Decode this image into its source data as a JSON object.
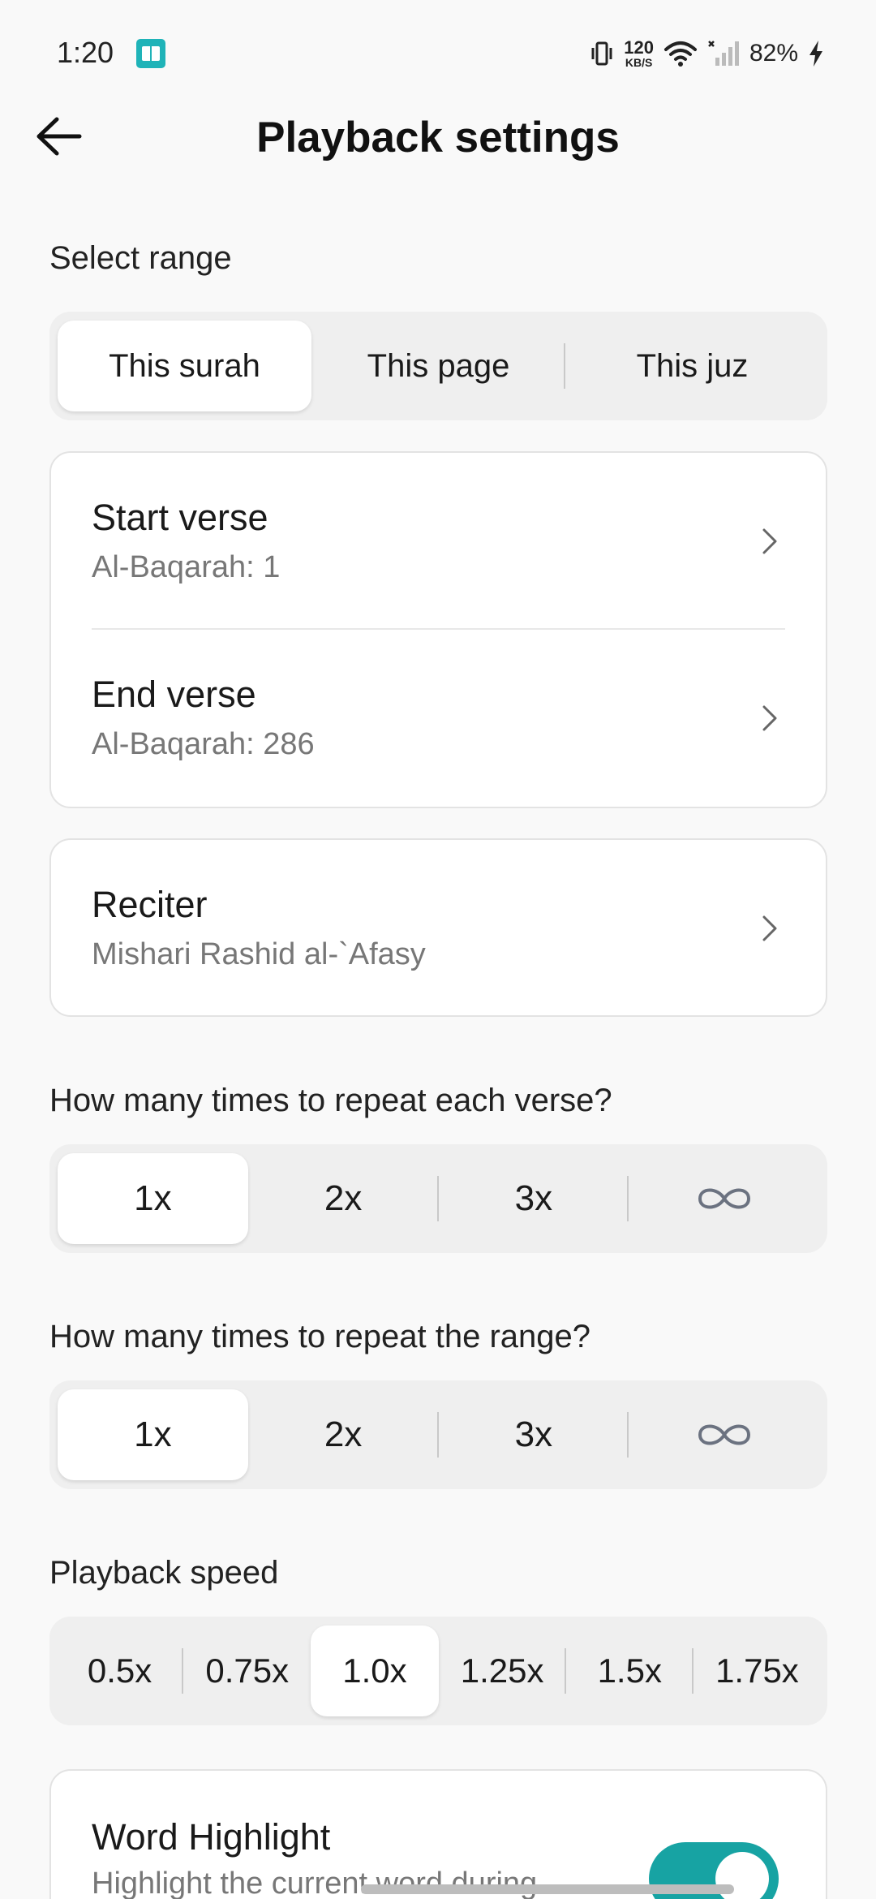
{
  "status_bar": {
    "time": "1:20",
    "net_speed_value": "120",
    "net_speed_unit": "KB/S",
    "battery": "82%"
  },
  "header": {
    "title": "Playback settings"
  },
  "range": {
    "label": "Select range",
    "options": [
      "This surah",
      "This page",
      "This juz"
    ],
    "selected": "This surah"
  },
  "verses": {
    "start_title": "Start verse",
    "start_value": "Al-Baqarah: 1",
    "end_title": "End verse",
    "end_value": "Al-Baqarah: 286"
  },
  "reciter": {
    "title": "Reciter",
    "value": "Mishari Rashid al-`Afasy"
  },
  "verse_repeat": {
    "label": "How many times to repeat each verse?",
    "options": [
      "1x",
      "2x",
      "3x"
    ],
    "selected": "1x"
  },
  "range_repeat": {
    "label": "How many times to repeat the range?",
    "options": [
      "1x",
      "2x",
      "3x"
    ],
    "selected": "1x"
  },
  "speed": {
    "label": "Playback speed",
    "options": [
      "0.5x",
      "0.75x",
      "1.0x",
      "1.25x",
      "1.5x",
      "1.75x"
    ],
    "selected": "1.0x"
  },
  "word_highlight": {
    "title": "Word Highlight",
    "subtitle": "Highlight the current word during",
    "enabled": true
  },
  "colors": {
    "accent": "#17a3a3",
    "background": "#f9f9f9",
    "segment_track": "#efefef"
  },
  "icons": {
    "back": "arrow-left-icon",
    "chevron": "chevron-right-icon",
    "infinity": "infinity-icon"
  }
}
